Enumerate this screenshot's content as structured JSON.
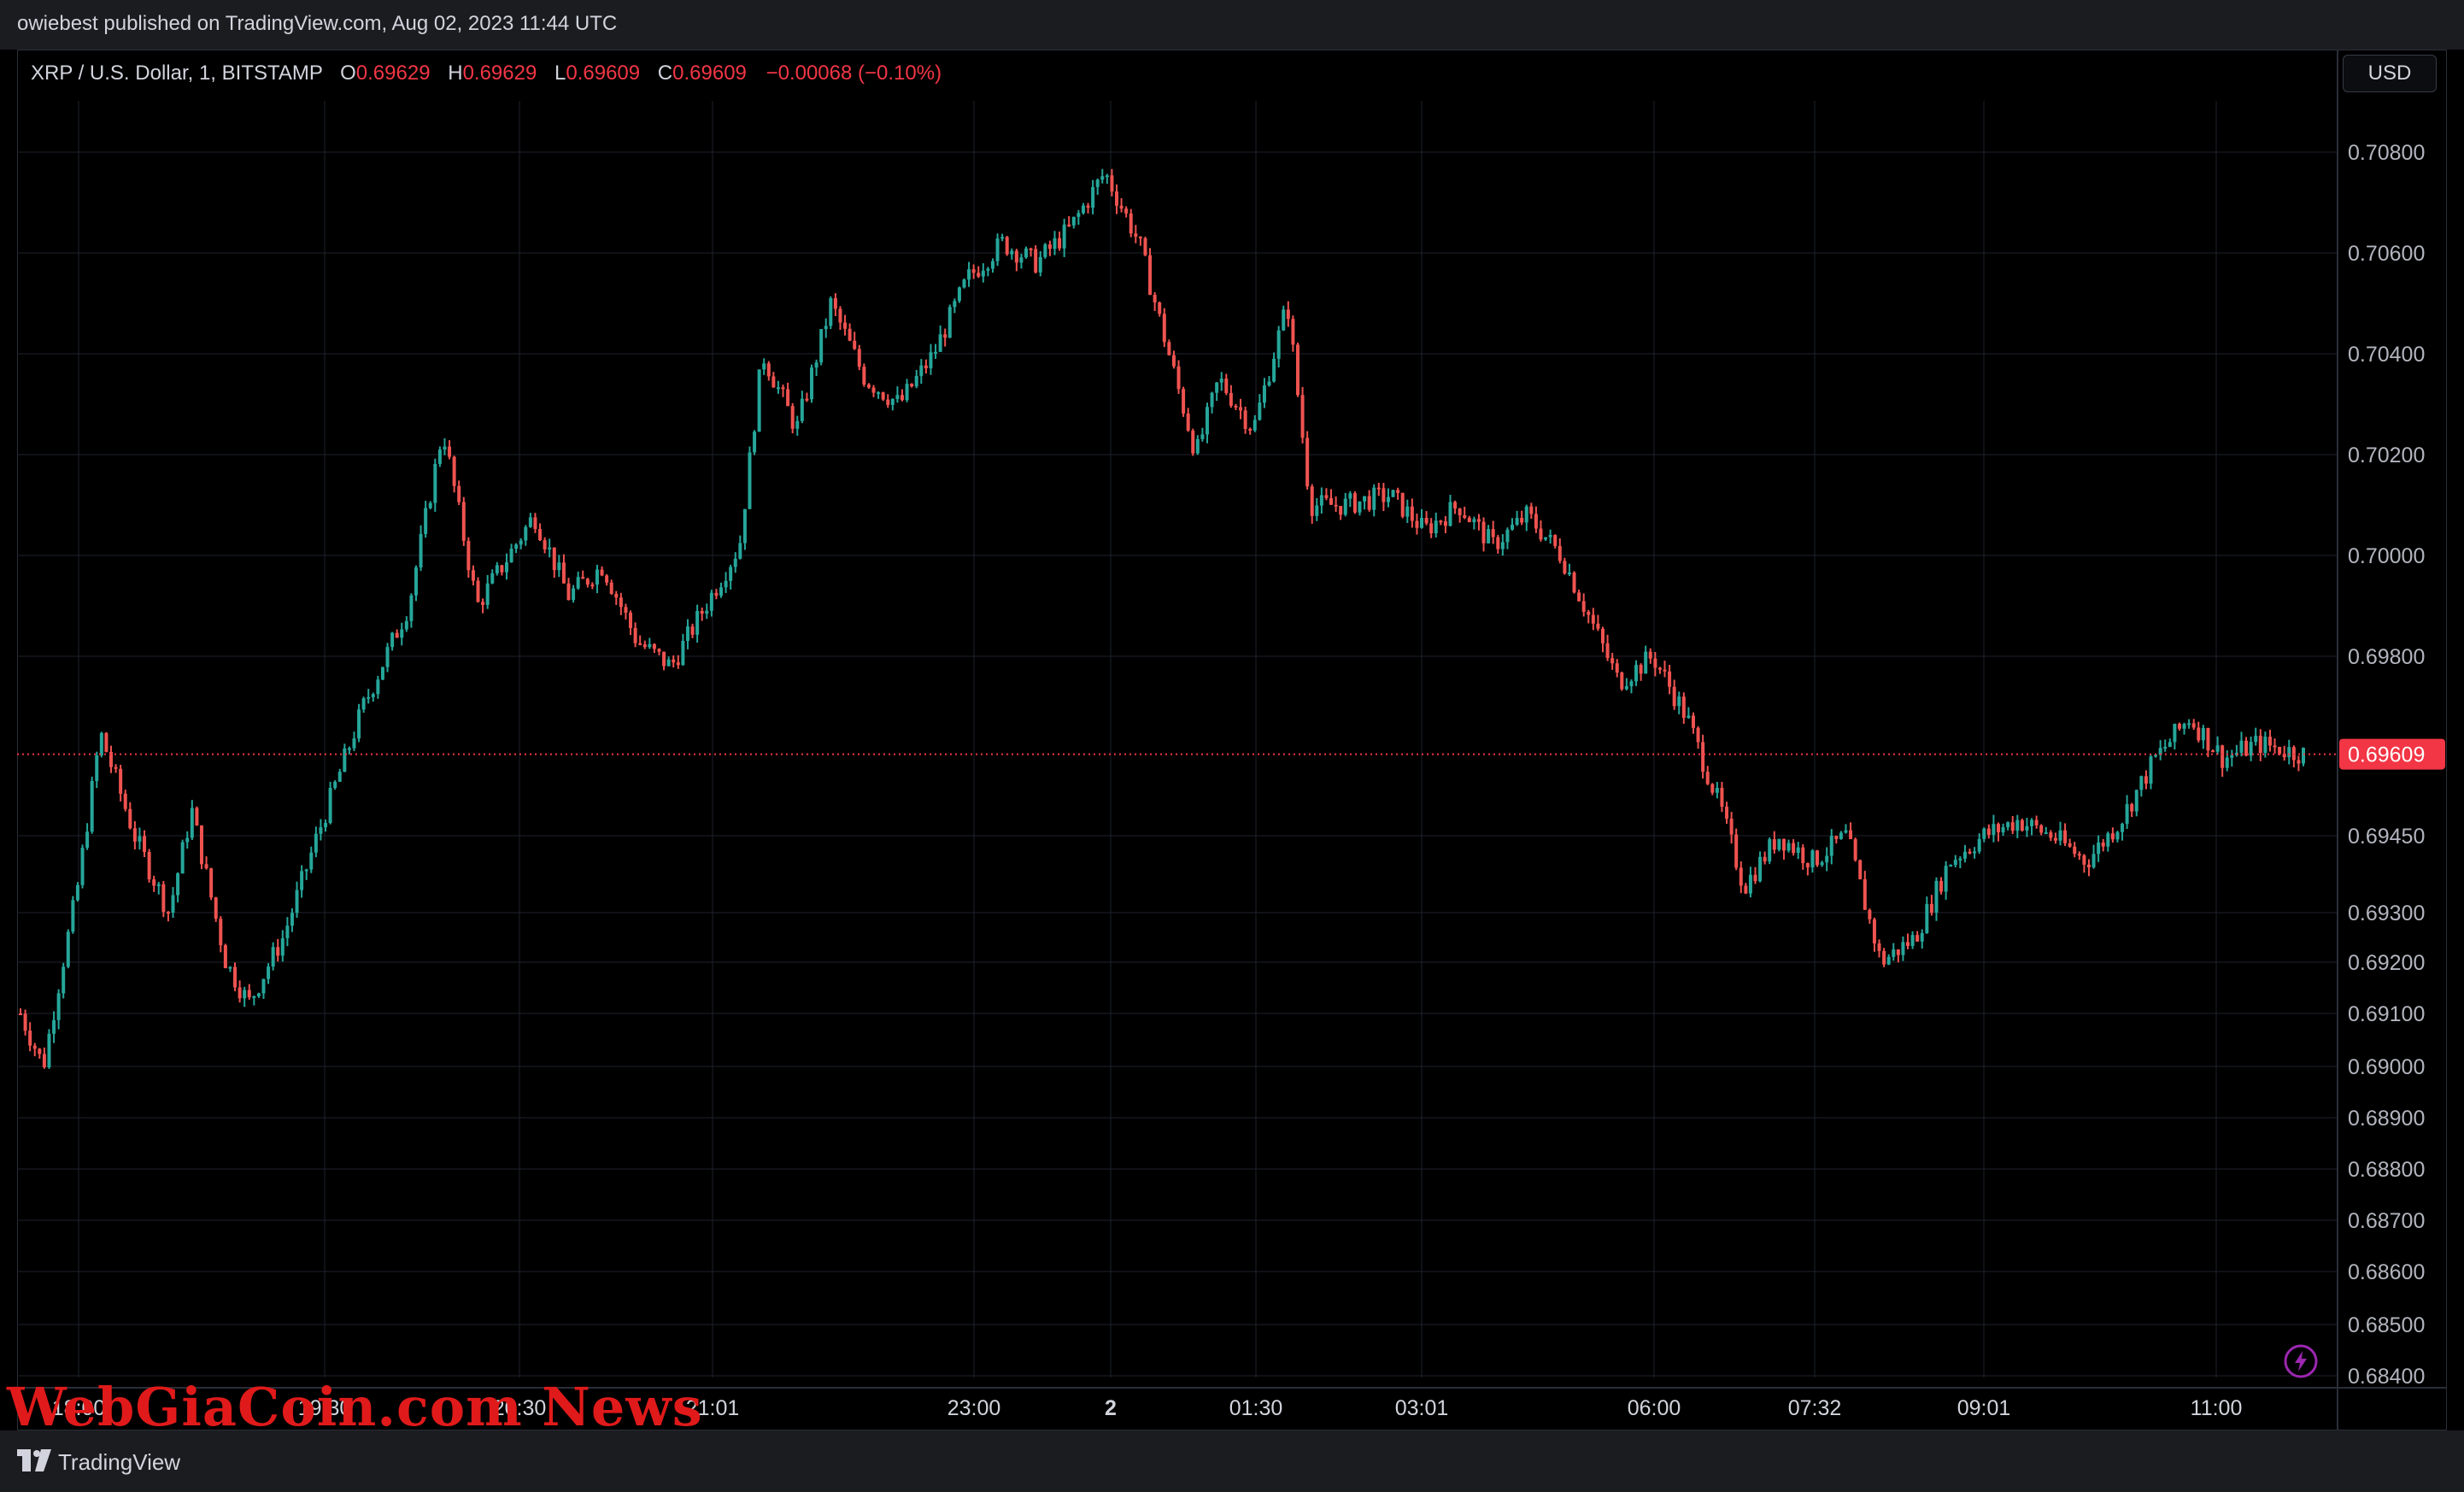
{
  "header": {
    "published": "owiebest published on TradingView.com, Aug 02, 2023 11:44 UTC"
  },
  "legend": {
    "symbol": "XRP / U.S. Dollar, 1, BITSTAMP",
    "o_label": "O",
    "o_value": "0.69629",
    "h_label": "H",
    "h_value": "0.69629",
    "l_label": "L",
    "l_value": "0.69609",
    "c_label": "C",
    "c_value": "0.69609",
    "change": "−0.00068 (−0.10%)"
  },
  "currency_button": "USD",
  "footer": {
    "brand": "TradingView"
  },
  "watermark": "WebGiaCoin.com News",
  "colors": {
    "up": "#26a69a",
    "down": "#ef5350",
    "last_price": "#f23645",
    "grid": "#1e222d"
  },
  "chart_data": {
    "type": "candlestick",
    "title": "XRP / U.S. Dollar, 1, BITSTAMP",
    "y_ticks": [
      "0.70800",
      "0.70600",
      "0.70400",
      "0.70200",
      "0.70000",
      "0.69800",
      "0.69450",
      "0.69300",
      "0.69200",
      "0.69100",
      "0.69000",
      "0.68900",
      "0.68800",
      "0.68700",
      "0.68600",
      "0.68500",
      "0.68400"
    ],
    "x_ticks": [
      "18:00",
      "19:30",
      "20:30",
      "21:01",
      "23:00",
      "2",
      "01:30",
      "03:01",
      "06:00",
      "07:32",
      "09:01",
      "11:00"
    ],
    "last_price": "0.69609",
    "grid": true,
    "series": [
      {
        "t": 0.0,
        "v": 0.691
      },
      {
        "t": 0.01,
        "v": 0.69
      },
      {
        "t": 0.025,
        "v": 0.6935
      },
      {
        "t": 0.035,
        "v": 0.6965
      },
      {
        "t": 0.05,
        "v": 0.6945
      },
      {
        "t": 0.065,
        "v": 0.693
      },
      {
        "t": 0.075,
        "v": 0.695
      },
      {
        "t": 0.09,
        "v": 0.692
      },
      {
        "t": 0.1,
        "v": 0.6912
      },
      {
        "t": 0.115,
        "v": 0.6925
      },
      {
        "t": 0.13,
        "v": 0.6945
      },
      {
        "t": 0.15,
        "v": 0.697
      },
      {
        "t": 0.17,
        "v": 0.699
      },
      {
        "t": 0.185,
        "v": 0.7025
      },
      {
        "t": 0.2,
        "v": 0.699
      },
      {
        "t": 0.225,
        "v": 0.7008
      },
      {
        "t": 0.24,
        "v": 0.6992
      },
      {
        "t": 0.255,
        "v": 0.6998
      },
      {
        "t": 0.27,
        "v": 0.6983
      },
      {
        "t": 0.285,
        "v": 0.6978
      },
      {
        "t": 0.3,
        "v": 0.699
      },
      {
        "t": 0.315,
        "v": 0.7002
      },
      {
        "t": 0.325,
        "v": 0.704
      },
      {
        "t": 0.34,
        "v": 0.7025
      },
      {
        "t": 0.355,
        "v": 0.705
      },
      {
        "t": 0.37,
        "v": 0.7035
      },
      {
        "t": 0.385,
        "v": 0.703
      },
      {
        "t": 0.4,
        "v": 0.704
      },
      {
        "t": 0.415,
        "v": 0.7055
      },
      {
        "t": 0.43,
        "v": 0.7062
      },
      {
        "t": 0.445,
        "v": 0.7058
      },
      {
        "t": 0.46,
        "v": 0.7065
      },
      {
        "t": 0.475,
        "v": 0.7076
      },
      {
        "t": 0.49,
        "v": 0.7062
      },
      {
        "t": 0.5,
        "v": 0.7045
      },
      {
        "t": 0.515,
        "v": 0.702
      },
      {
        "t": 0.525,
        "v": 0.7035
      },
      {
        "t": 0.54,
        "v": 0.7025
      },
      {
        "t": 0.555,
        "v": 0.705
      },
      {
        "t": 0.565,
        "v": 0.701
      },
      {
        "t": 0.58,
        "v": 0.701
      },
      {
        "t": 0.6,
        "v": 0.7012
      },
      {
        "t": 0.615,
        "v": 0.7005
      },
      {
        "t": 0.63,
        "v": 0.701
      },
      {
        "t": 0.645,
        "v": 0.7002
      },
      {
        "t": 0.66,
        "v": 0.7008
      },
      {
        "t": 0.675,
        "v": 0.7
      },
      {
        "t": 0.69,
        "v": 0.6985
      },
      {
        "t": 0.7,
        "v": 0.6975
      },
      {
        "t": 0.715,
        "v": 0.698
      },
      {
        "t": 0.73,
        "v": 0.6968
      },
      {
        "t": 0.745,
        "v": 0.695
      },
      {
        "t": 0.755,
        "v": 0.6935
      },
      {
        "t": 0.77,
        "v": 0.6945
      },
      {
        "t": 0.785,
        "v": 0.694
      },
      {
        "t": 0.8,
        "v": 0.6945
      },
      {
        "t": 0.815,
        "v": 0.692
      },
      {
        "t": 0.83,
        "v": 0.6925
      },
      {
        "t": 0.845,
        "v": 0.694
      },
      {
        "t": 0.86,
        "v": 0.6945
      },
      {
        "t": 0.875,
        "v": 0.6948
      },
      {
        "t": 0.89,
        "v": 0.6945
      },
      {
        "t": 0.905,
        "v": 0.694
      },
      {
        "t": 0.92,
        "v": 0.6948
      },
      {
        "t": 0.935,
        "v": 0.696
      },
      {
        "t": 0.95,
        "v": 0.6968
      },
      {
        "t": 0.965,
        "v": 0.696
      },
      {
        "t": 0.98,
        "v": 0.6963
      },
      {
        "t": 1.0,
        "v": 0.69609
      }
    ]
  }
}
